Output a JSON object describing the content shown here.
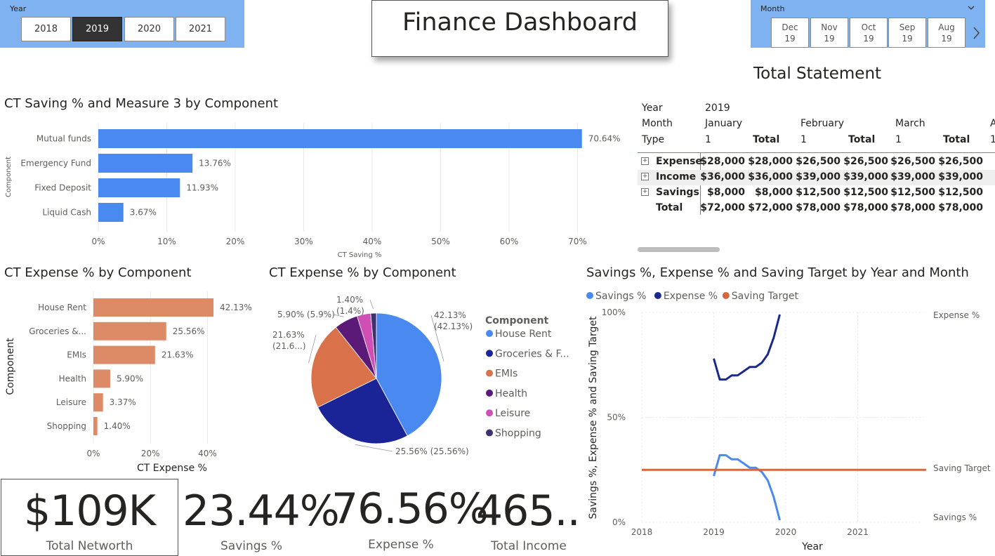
{
  "dashboard_title": "Finance Dashboard",
  "year_slicer": {
    "title": "Year",
    "options": [
      "2018",
      "2019",
      "2020",
      "2021"
    ],
    "selected": "2019"
  },
  "month_slicer": {
    "title": "Month",
    "options": [
      {
        "month": "Dec",
        "year": "19"
      },
      {
        "month": "Nov",
        "year": "19"
      },
      {
        "month": "Oct",
        "year": "19"
      },
      {
        "month": "Sep",
        "year": "19"
      },
      {
        "month": "Aug",
        "year": "19"
      }
    ]
  },
  "statement": {
    "title": "Total Statement",
    "row_year_label": "Year",
    "year_value": "2019",
    "row_month_label": "Month",
    "months": [
      "January",
      "February",
      "March",
      "A"
    ],
    "row_type_label": "Type",
    "type_headers": [
      "1",
      "Total",
      "1",
      "Total",
      "1",
      "Total",
      "1"
    ],
    "rows": [
      {
        "label": "Expense",
        "expandable": true,
        "values": [
          "$28,000",
          "$28,000",
          "$26,500",
          "$26,500",
          "$26,500",
          "$26,500",
          "$"
        ]
      },
      {
        "label": "Income",
        "expandable": true,
        "values": [
          "$36,000",
          "$36,000",
          "$39,000",
          "$39,000",
          "$39,000",
          "$39,000",
          "$"
        ]
      },
      {
        "label": "Savings",
        "expandable": true,
        "values": [
          "$8,000",
          "$8,000",
          "$12,500",
          "$12,500",
          "$12,500",
          "$12,500",
          "$"
        ]
      },
      {
        "label": "Total",
        "expandable": false,
        "values": [
          "$72,000",
          "$72,000",
          "$78,000",
          "$78,000",
          "$78,000",
          "$78,000",
          "$"
        ]
      }
    ]
  },
  "cards": [
    {
      "value": "$109K",
      "label": "Total Networth"
    },
    {
      "value": "23.44%",
      "label": "Savings %"
    },
    {
      "value": "76.56%",
      "label": "Expense %"
    },
    {
      "value": "465....",
      "label": "Total Income"
    }
  ],
  "colors": {
    "saving_bar": "#4a8af0",
    "expense_bar": "#dd8b66",
    "savings_line": "#4a8af0",
    "expense_line": "#1a2a8c",
    "target_line": "#d4683e",
    "slicer_bg": "#7fb2f0"
  },
  "chart_data": [
    {
      "type": "bar",
      "title": "CT Saving % and Measure 3 by Component",
      "categories": [
        "Mutual funds",
        "Emergency Fund",
        "Fixed Deposit",
        "Liquid Cash"
      ],
      "values": [
        70.64,
        13.76,
        11.93,
        3.67
      ],
      "data_labels": [
        "70.64%",
        "13.76%",
        "11.93%",
        "3.67%"
      ],
      "xlabel": "CT Saving %",
      "ylabel": "Component",
      "xlim": [
        0,
        70
      ],
      "xticks": [
        "0%",
        "10%",
        "20%",
        "30%",
        "40%",
        "50%",
        "60%",
        "70%"
      ]
    },
    {
      "type": "bar",
      "title": "CT Expense % by Component",
      "categories": [
        "House Rent",
        "Groceries &...",
        "EMIs",
        "Health",
        "Leisure",
        "Shopping"
      ],
      "values": [
        42.13,
        25.56,
        21.63,
        5.9,
        3.37,
        1.4
      ],
      "data_labels": [
        "42.13%",
        "25.56%",
        "21.63%",
        "5.90%",
        "3.37%",
        "1.40%"
      ],
      "xlabel": "CT Expense %",
      "ylabel": "Component",
      "xlim": [
        0,
        40
      ],
      "xticks": [
        "0%",
        "20%",
        "40%"
      ]
    },
    {
      "type": "pie",
      "title": "CT Expense % by Component",
      "legend_title": "Component",
      "slices": [
        {
          "label": "House Rent",
          "legend": "House Rent",
          "value": 42.13,
          "color": "#4a8af0",
          "data_label": "42.13%",
          "data_label2": "(42.13%)"
        },
        {
          "label": "Groceries & Food",
          "legend": "Groceries & F...",
          "value": 25.56,
          "color": "#1a2496",
          "data_label": "25.56% (25.56%)",
          "data_label2": ""
        },
        {
          "label": "EMIs",
          "legend": "EMIs",
          "value": 21.63,
          "color": "#d9724a",
          "data_label": "21.63%",
          "data_label2": "(21.6...)"
        },
        {
          "label": "Health",
          "legend": "Health",
          "value": 5.9,
          "color": "#5c1a78",
          "data_label": "5.90% (5.9%)",
          "data_label2": ""
        },
        {
          "label": "Leisure",
          "legend": "Leisure",
          "value": 3.37,
          "color": "#d04fb4",
          "data_label": "",
          "data_label2": ""
        },
        {
          "label": "Shopping",
          "legend": "Shopping",
          "value": 1.4,
          "color": "#3f3070",
          "data_label": "1.40%",
          "data_label2": "(1.4%)"
        }
      ]
    },
    {
      "type": "line",
      "title": "Savings %, Expense % and Saving Target by Year and Month",
      "xlabel": "Year",
      "ylabel": "Savings %, Expense % and Saving Target",
      "xticks": [
        "2018",
        "2019",
        "2020",
        "2021"
      ],
      "yticks": [
        "0%",
        "50%",
        "100%"
      ],
      "xlim": [
        2018,
        2022
      ],
      "ylim": [
        0,
        100
      ],
      "series": [
        {
          "name": "Savings %",
          "color": "#4a8af0",
          "end_label": "Savings %",
          "x": [
            2019.0,
            2019.083,
            2019.167,
            2019.25,
            2019.333,
            2019.417,
            2019.5,
            2019.583,
            2019.667,
            2019.75,
            2019.833,
            2019.917
          ],
          "y": [
            22,
            32,
            32,
            30,
            30,
            28,
            26,
            26,
            24,
            20,
            12,
            1
          ]
        },
        {
          "name": "Expense %",
          "color": "#1a2a8c",
          "end_label": "Expense %",
          "x": [
            2019.0,
            2019.083,
            2019.167,
            2019.25,
            2019.333,
            2019.417,
            2019.5,
            2019.583,
            2019.667,
            2019.75,
            2019.833,
            2019.917
          ],
          "y": [
            78,
            68,
            68,
            70,
            70,
            72,
            74,
            74,
            76,
            80,
            88,
            99
          ]
        },
        {
          "name": "Saving Target",
          "color": "#d4683e",
          "end_label": "Saving Target",
          "x": [
            2018.0,
            2021.95
          ],
          "y": [
            25,
            25
          ]
        }
      ]
    }
  ]
}
